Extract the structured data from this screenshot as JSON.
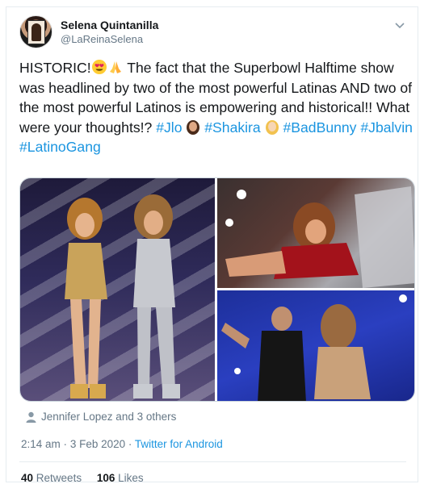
{
  "author": {
    "display_name": "Selena Quintanilla",
    "handle": "@LaReinaSelena"
  },
  "tweet": {
    "text_1": "HISTORIC!",
    "text_2": " The fact that the Superbowl Halftime show was headlined by two of the most powerful Latinas AND two of the most powerful Latinos is empowering and historical!! What were your thoughts!? ",
    "hashtags": [
      "#Jlo",
      "#Shakira",
      "#BadBunny",
      "#Jbalvin",
      "#LatinoGang"
    ]
  },
  "media": {
    "images": [
      "performers-on-stage",
      "dancer-red-outfit",
      "performer-blue-stage"
    ]
  },
  "likers": "Jennifer Lopez and 3 others",
  "meta": {
    "time": "2:14 am",
    "dot": "·",
    "date": "3 Feb 2020",
    "source": "Twitter for Android"
  },
  "stats": {
    "retweets_count": "40",
    "retweets_label": "Retweets",
    "likes_count": "106",
    "likes_label": "Likes"
  },
  "colors": {
    "link": "#1b95e0",
    "muted": "#657786",
    "text": "#14171a"
  },
  "icons": [
    "chevron-down-icon",
    "heart-eyes-emoji",
    "praying-hands-emoji",
    "person-icon"
  ]
}
